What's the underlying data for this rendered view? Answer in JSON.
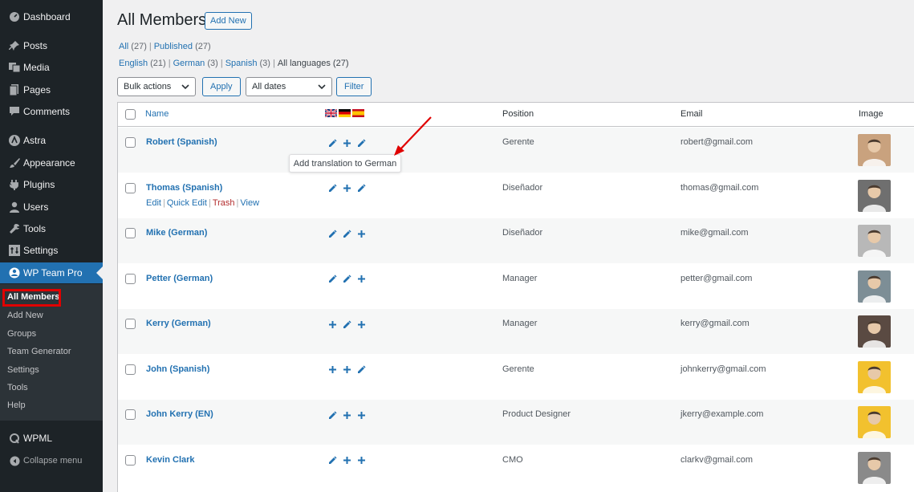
{
  "sidebar": {
    "items": [
      {
        "icon": "dashboard-icon",
        "label": "Dashboard"
      },
      {
        "icon": "pin-icon",
        "label": "Posts"
      },
      {
        "icon": "media-icon",
        "label": "Media"
      },
      {
        "icon": "pages-icon",
        "label": "Pages"
      },
      {
        "icon": "comments-icon",
        "label": "Comments"
      },
      {
        "icon": "astra-icon",
        "label": "Astra"
      },
      {
        "icon": "appearance-icon",
        "label": "Appearance"
      },
      {
        "icon": "plugins-icon",
        "label": "Plugins"
      },
      {
        "icon": "users-icon",
        "label": "Users"
      },
      {
        "icon": "tools-icon",
        "label": "Tools"
      },
      {
        "icon": "settings-icon",
        "label": "Settings"
      },
      {
        "icon": "team-pro-icon",
        "label": "WP Team Pro"
      }
    ],
    "submenu": [
      "All Members",
      "Add New",
      "Groups",
      "Team Generator",
      "Settings",
      "Tools",
      "Help"
    ],
    "wpml": "WPML",
    "collapse": "Collapse menu"
  },
  "header": {
    "title": "All Members",
    "add_new": "Add New"
  },
  "filters": {
    "all": "All",
    "all_count": "(27)",
    "published": "Published",
    "published_count": "(27)",
    "english": "English",
    "english_count": "(21)",
    "german": "German",
    "german_count": "(3)",
    "spanish": "Spanish",
    "spanish_count": "(3)",
    "all_languages": "All languages (27)"
  },
  "toolbar": {
    "bulk_actions": "Bulk actions",
    "apply": "Apply",
    "all_dates": "All dates",
    "filter": "Filter"
  },
  "table": {
    "columns": {
      "name": "Name",
      "position": "Position",
      "email": "Email",
      "image": "Image"
    },
    "row_actions": {
      "edit": "Edit",
      "quick_edit": "Quick Edit",
      "trash": "Trash",
      "view": "View"
    },
    "rows": [
      {
        "name": "Robert (Spanish)",
        "position": "Gerente",
        "email": "robert@gmail.com",
        "icons": [
          "edit",
          "add",
          "edit"
        ],
        "avatar": "#c9a27e"
      },
      {
        "name": "Thomas (Spanish)",
        "position": "Diseñador",
        "email": "thomas@gmail.com",
        "icons": [
          "edit",
          "add",
          "edit"
        ],
        "avatar": "#6f6f6f"
      },
      {
        "name": "Mike (German)",
        "position": "Diseñador",
        "email": "mike@gmail.com",
        "icons": [
          "edit",
          "edit",
          "add"
        ],
        "avatar": "#b8b8b8"
      },
      {
        "name": "Petter (German)",
        "position": "Manager",
        "email": "petter@gmail.com",
        "icons": [
          "edit",
          "edit",
          "add"
        ],
        "avatar": "#7d8e96"
      },
      {
        "name": "Kerry (German)",
        "position": "Manager",
        "email": "kerry@gmail.com",
        "icons": [
          "add",
          "edit",
          "add"
        ],
        "avatar": "#5a4a42"
      },
      {
        "name": "John (Spanish)",
        "position": "Gerente",
        "email": "johnkerry@gmail.com",
        "icons": [
          "add",
          "add",
          "edit"
        ],
        "avatar": "#f2c12e"
      },
      {
        "name": "John Kerry (EN)",
        "position": "Product Designer",
        "email": "jkerry@example.com",
        "icons": [
          "edit",
          "add",
          "add"
        ],
        "avatar": "#f2c12e"
      },
      {
        "name": "Kevin Clark",
        "position": "CMO",
        "email": "clarkv@gmail.com",
        "icons": [
          "edit",
          "add",
          "add"
        ],
        "avatar": "#8a8a8a"
      }
    ]
  },
  "tooltip": "Add translation to German",
  "colors": {
    "accent": "#2271b1",
    "sidebar_bg": "#1d2327",
    "highlight": "#e00000"
  }
}
